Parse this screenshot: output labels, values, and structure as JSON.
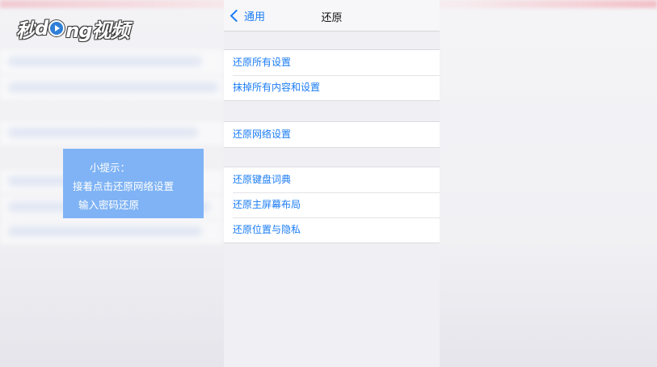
{
  "watermark": {
    "logo_text_a": "秒",
    "logo_text_b": "d",
    "logo_text_c": "ng视频",
    "logo_icon": "play-circle-icon"
  },
  "navbar": {
    "back_label": "通用",
    "back_icon": "chevron-left-icon",
    "title": "还原"
  },
  "groups": [
    {
      "items": [
        "还原所有设置",
        "抹掉所有内容和设置"
      ]
    },
    {
      "items": [
        "还原网络设置"
      ]
    },
    {
      "items": [
        "还原键盘词典",
        "还原主屏幕布局",
        "还原位置与隐私"
      ]
    }
  ],
  "tip": {
    "line1": "小提示：",
    "line2": "接着点击还原网络设置",
    "line3": "输入密码还原"
  },
  "colors": {
    "link_blue": "#1a7cf5",
    "tip_bg": "#7fb3f5",
    "panel_bg": "#efeff4"
  }
}
